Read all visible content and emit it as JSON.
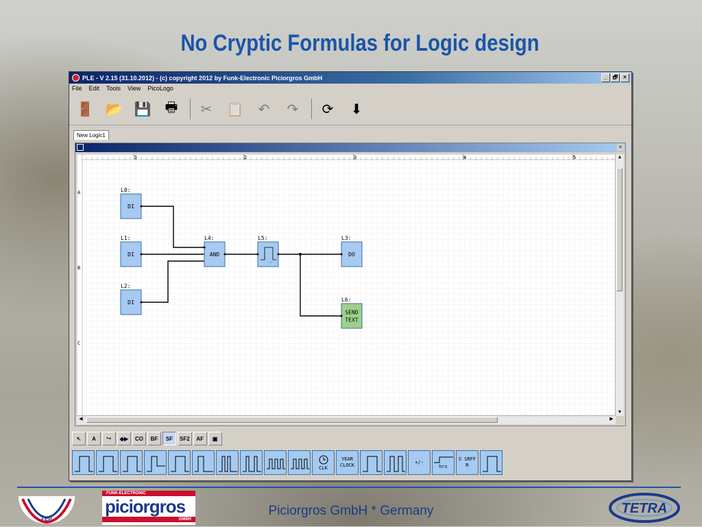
{
  "slide": {
    "title": "No Cryptic Formulas for Logic design",
    "footer": "Piciorgros GmbH * Germany"
  },
  "logos": {
    "fep_label": "FEP",
    "picio_top": "FUNK-ELECTRONIC",
    "picio_name": "piciorgros",
    "picio_bottom": "GMBH",
    "tetra": "TETRA"
  },
  "window": {
    "title": "PLE - V 2.15 (31.10.2012) - (c) copyright 2012 by Funk-Electronic Piciorgros GmbH",
    "buttons": [
      "_",
      "🗗",
      "×"
    ],
    "menu": [
      "File",
      "Edit",
      "Tools",
      "View",
      "PicoLogo"
    ],
    "toolbar": [
      {
        "name": "exit-icon",
        "glyph": "🚪",
        "enabled": true
      },
      {
        "name": "open-folder-icon",
        "glyph": "📂",
        "enabled": true
      },
      {
        "name": "save-icon",
        "glyph": "💾",
        "enabled": true
      },
      {
        "name": "print-icon",
        "glyph": "🖶",
        "enabled": true
      },
      {
        "name": "cut-icon",
        "glyph": "✂",
        "enabled": false
      },
      {
        "name": "paste-icon",
        "glyph": "📋",
        "enabled": false
      },
      {
        "name": "undo-icon",
        "glyph": "↶",
        "enabled": false
      },
      {
        "name": "redo-icon",
        "glyph": "↷",
        "enabled": false
      },
      {
        "name": "refresh-icon",
        "glyph": "⟳",
        "enabled": true
      },
      {
        "name": "download-icon",
        "glyph": "⬇",
        "enabled": true
      }
    ],
    "tab": "New Logic1"
  },
  "ruler": {
    "columns": [
      "1",
      "2",
      "3",
      "4",
      "5"
    ],
    "rows": [
      "A",
      "B",
      "C"
    ]
  },
  "blocks": [
    {
      "id": "L0",
      "label": "L0:",
      "text": "DI",
      "kind": "input"
    },
    {
      "id": "L1",
      "label": "L1:",
      "text": "DI",
      "kind": "input"
    },
    {
      "id": "L2",
      "label": "L2:",
      "text": "DI",
      "kind": "input"
    },
    {
      "id": "L4",
      "label": "L4:",
      "text": "AND",
      "kind": "logic"
    },
    {
      "id": "L5",
      "label": "L5:",
      "text": "",
      "kind": "timer"
    },
    {
      "id": "L3",
      "label": "L3:",
      "text": "DO",
      "kind": "output"
    },
    {
      "id": "L6",
      "label": "L6:",
      "text": "SEND TEXT",
      "kind": "special"
    }
  ],
  "palette": {
    "tools": [
      {
        "name": "select-tool",
        "text": "↖",
        "active": false
      },
      {
        "name": "text-tool",
        "text": "A",
        "active": false
      },
      {
        "name": "connect-tool",
        "text": "⮡",
        "active": false
      },
      {
        "name": "signal-tool",
        "text": "◆▶",
        "active": false
      },
      {
        "name": "co-button",
        "text": "CO",
        "active": false
      },
      {
        "name": "bf-button",
        "text": "BF",
        "active": false
      },
      {
        "name": "sf-button",
        "text": "SF",
        "active": true
      },
      {
        "name": "sf2-button",
        "text": "SF2",
        "active": false
      },
      {
        "name": "af-button",
        "text": "AF",
        "active": false
      },
      {
        "name": "monitor-button",
        "text": "▣",
        "active": false
      }
    ],
    "functions": [
      {
        "name": "on-delay",
        "text": ""
      },
      {
        "name": "off-delay",
        "text": ""
      },
      {
        "name": "on-off-delay",
        "text": ""
      },
      {
        "name": "retentive-on-delay",
        "text": ""
      },
      {
        "name": "pulse-relay",
        "text": ""
      },
      {
        "name": "edge-pulse",
        "text": ""
      },
      {
        "name": "asym-pulse",
        "text": ""
      },
      {
        "name": "random-pulse",
        "text": ""
      },
      {
        "name": "clock-pulse",
        "text": ""
      },
      {
        "name": "clock-pulse-2",
        "text": ""
      },
      {
        "name": "clk",
        "text": "CLK"
      },
      {
        "name": "year-clock",
        "text": "YEAR CLOCK"
      },
      {
        "name": "stair-light",
        "text": ""
      },
      {
        "name": "multi-switch",
        "text": ""
      },
      {
        "name": "up-down-counter",
        "text": "+/-"
      },
      {
        "name": "hours-counter",
        "text": "hrs"
      },
      {
        "name": "srff",
        "text": "S SRFF R"
      },
      {
        "name": "pulse-gen",
        "text": ""
      }
    ]
  }
}
